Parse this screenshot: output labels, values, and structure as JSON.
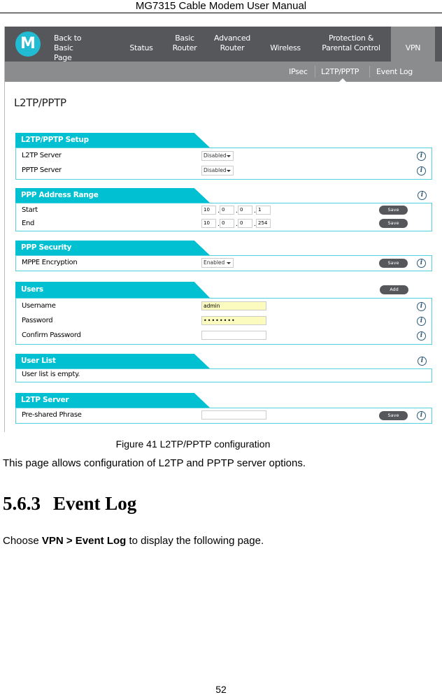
{
  "doc": {
    "header": "MG7315 Cable Modem User Manual",
    "caption": "Figure 41 L2TP/PPTP configuration",
    "para1": "This page allows configuration of L2TP and PPTP server options.",
    "section_number": "5.6.3",
    "section_title": "Event Log",
    "para2_pre": "Choose ",
    "para2_bold": "VPN > Event Log",
    "para2_post": " to display the following page.",
    "page_number": "52"
  },
  "ui": {
    "brand_color": "#21bcd4",
    "accent": "#00c0d2",
    "nav": [
      "Back to\nBasic Page",
      "Status",
      "Basic\nRouter",
      "Advanced\nRouter",
      "Wireless",
      "Protection &\nParental Control",
      "VPN"
    ],
    "subnav": [
      "IPsec",
      "L2TP/PPTP",
      "Event Log"
    ],
    "page_title": "L2TP/PPTP",
    "setup": {
      "title": "L2TP/PPTP Setup",
      "l2tp_label": "L2TP Server",
      "l2tp_value": "Disabled",
      "pptp_label": "PPTP Server",
      "pptp_value": "Disabled"
    },
    "range": {
      "title": "PPP Address Range",
      "start_label": "Start",
      "start": [
        "10",
        "0",
        "0",
        "1"
      ],
      "end_label": "End",
      "end": [
        "10",
        "0",
        "0",
        "254"
      ],
      "save": "Save"
    },
    "security": {
      "title": "PPP Security",
      "mppe_label": "MPPE Encryption",
      "mppe_value": "Enabled",
      "save": "Save"
    },
    "users": {
      "title": "Users",
      "add": "Add",
      "username_label": "Username",
      "username": "admin",
      "password_label": "Password",
      "password": "••••••••",
      "confirm_label": "Confirm Password",
      "confirm": ""
    },
    "userlist": {
      "title": "User List",
      "empty": "User list is empty."
    },
    "server": {
      "title": "L2TP Server",
      "psk_label": "Pre-shared Phrase",
      "psk": "",
      "save": "Save"
    },
    "info_icon": "i"
  }
}
